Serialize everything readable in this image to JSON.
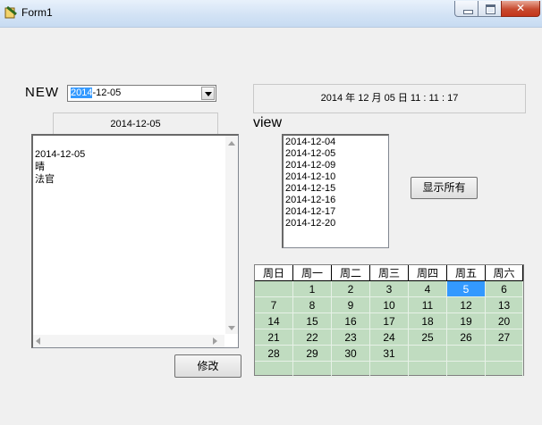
{
  "window": {
    "title": "Form1"
  },
  "left": {
    "new_label": "NEW",
    "date_combo": {
      "value_sel": "2014",
      "value_rest": "-12-05"
    },
    "tab_label": "2014-12-05",
    "memo_lines": [
      "2014-12-05",
      "晴",
      "法官"
    ],
    "modify_label": "修改"
  },
  "right": {
    "datetime_text": "2014 年 12 月 05 日   11 : 11 : 17",
    "view_label": "view",
    "list_items": [
      "2014-12-04",
      "2014-12-05",
      "2014-12-09",
      "2014-12-10",
      "2014-12-15",
      "2014-12-16",
      "2014-12-17",
      "2014-12-20"
    ],
    "show_all_label": "显示所有"
  },
  "calendar": {
    "headers": [
      "周日",
      "周一",
      "周二",
      "周三",
      "周四",
      "周五",
      "周六"
    ],
    "rows": [
      [
        "",
        "1",
        "2",
        "3",
        "4",
        "5",
        "6"
      ],
      [
        "7",
        "8",
        "9",
        "10",
        "11",
        "12",
        "13"
      ],
      [
        "14",
        "15",
        "16",
        "17",
        "18",
        "19",
        "20"
      ],
      [
        "21",
        "22",
        "23",
        "24",
        "25",
        "26",
        "27"
      ],
      [
        "28",
        "29",
        "30",
        "31",
        "",
        "",
        ""
      ],
      [
        "",
        "",
        "",
        "",
        "",
        "",
        ""
      ]
    ],
    "selected_day": "5",
    "colors": {
      "cell_bg": "#c0dcc0",
      "selected_bg": "#3399ff"
    }
  }
}
